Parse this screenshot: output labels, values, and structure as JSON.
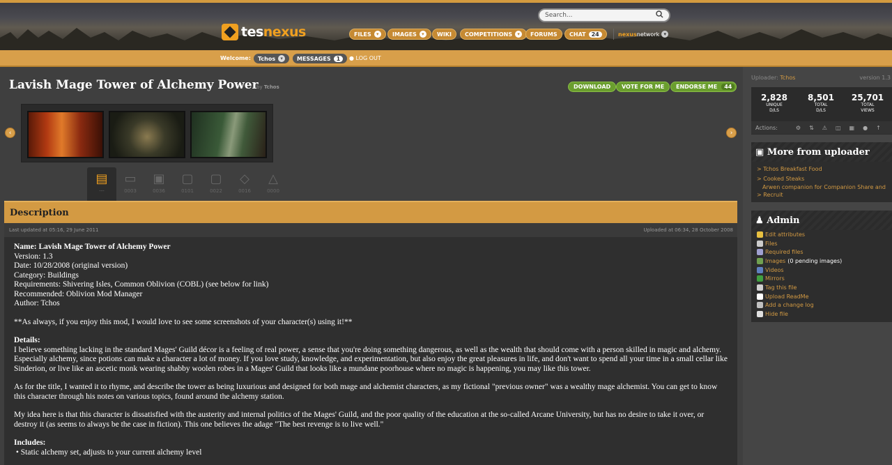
{
  "header": {
    "logo_prefix": "tes",
    "logo_suffix": "nexus",
    "search_placeholder": "Search...",
    "nav": [
      {
        "label": "FILES"
      },
      {
        "label": "IMAGES"
      },
      {
        "label": "WIKI"
      },
      {
        "label": "COMPETITIONS"
      },
      {
        "label": "FORUMS"
      },
      {
        "label": "CHAT",
        "badge": "24"
      }
    ],
    "network_prefix": "nexus",
    "network_suffix": "network"
  },
  "welcome_bar": {
    "label": "Welcome:",
    "user": "Tchos",
    "messages_label": "MESSAGES",
    "messages_count": "1",
    "logout": "LOG OUT"
  },
  "file": {
    "title": "Lavish Mage Tower of Alchemy Power",
    "by": "by",
    "author": "Tchos",
    "buttons": {
      "download": "DOWNLOAD",
      "vote": "VOTE FOR ME",
      "endorse": "ENDORSE ME",
      "endorse_count": "44"
    }
  },
  "tabs": [
    {
      "name": "description",
      "icon": "document-icon",
      "label": "---"
    },
    {
      "name": "files",
      "icon": "folder-icon",
      "label": "0003"
    },
    {
      "name": "images",
      "icon": "image-icon",
      "label": "0036"
    },
    {
      "name": "comments",
      "icon": "comment-icon",
      "label": "0101"
    },
    {
      "name": "forum",
      "icon": "chat-icon",
      "label": "0022"
    },
    {
      "name": "tags",
      "icon": "tag-icon",
      "label": "0016"
    },
    {
      "name": "versions",
      "icon": "triangle-icon",
      "label": "0000"
    }
  ],
  "description": {
    "header": "Description",
    "last_updated": "Last updated at 05:16, 29 June 2011",
    "uploaded": "Uploaded at 06:34, 28 October 2008",
    "info": {
      "name": "Name: Lavish Mage Tower of Alchemy Power",
      "version": "Version: 1.3",
      "date": "Date: 10/28/2008 (original version)",
      "category": "Category: Buildings",
      "requirements": "Requirements: Shivering Isles, Common Oblivion (COBL) (see below for link)",
      "recommended": "Recommended: Oblivion Mod Manager",
      "author": "Author: Tchos"
    },
    "note": "**As always, if you enjoy this mod, I would love to see some screenshots of your character(s) using it!**",
    "details_title": "Details:",
    "details_text": "I believe something lacking in the standard Mages' Guild décor is a feeling of real power, a sense that you're doing something dangerous, as well as the wealth that should come with a person skilled in magic and alchemy. Especially alchemy, since potions can make a character a lot of money. If you love study, knowledge, and experimentation, but also enjoy the great pleasures in life, and don't want to spend all your time in a small cellar like Sinderion, or live like an ascetic monk wearing shabby woolen robes in a Mages' Guild that looks like a mundane poorhouse where no magic is happening, you may like this tower.",
    "para2": "As for the title, I wanted it to rhyme, and describe the tower as being luxurious and designed for both mage and alchemist characters, as my fictional \"previous owner\" was a wealthy mage alchemist. You can get to know this character through his notes on various topics, found around the alchemy station.",
    "para3": "My idea here is that this character is dissatisfied with the austerity and internal politics of the Mages' Guild, and the poor quality of the education at the so-called Arcane University, but has no desire to take it over, or destroy it (as seems to always be the case in fiction). This one believes the adage \"The best revenge is to live well.\"",
    "includes_title": "Includes:",
    "includes_first": "Static alchemy set, adjusts to your current alchemy level"
  },
  "sidebar": {
    "uploader_label": "Uploader:",
    "uploader": "Tchos",
    "version": "version 1.3",
    "stats": [
      {
        "value": "2,828",
        "l1": "UNIQUE",
        "l2": "D/LS"
      },
      {
        "value": "8,501",
        "l1": "TOTAL",
        "l2": "D/LS"
      },
      {
        "value": "25,701",
        "l1": "TOTAL",
        "l2": "VIEWS"
      }
    ],
    "actions_label": "Actions:",
    "more_title": "More from uploader",
    "more_items": [
      "> Tchos Breakfast Food",
      "> Cooked Steaks",
      "Arwen companion for Companion Share and",
      "> Recruit"
    ],
    "admin_title": "Admin",
    "admin_items": [
      {
        "label": "Edit attributes",
        "extra": "",
        "color": "#e8c040"
      },
      {
        "label": "Files",
        "extra": "",
        "color": "#cccccc"
      },
      {
        "label": "Required files",
        "extra": "",
        "color": "#a0a0d0"
      },
      {
        "label": "Images",
        "extra": " (0 pending images)",
        "color": "#70a050"
      },
      {
        "label": "Videos",
        "extra": "",
        "color": "#6080c0"
      },
      {
        "label": "Mirrors",
        "extra": "",
        "color": "#40a040"
      },
      {
        "label": "Tag this file",
        "extra": "",
        "color": "#d0d0d0"
      },
      {
        "label": "Upload ReadMe",
        "extra": "",
        "color": "#ffffff"
      },
      {
        "label": "Add a change log",
        "extra": "",
        "color": "#c0c0c0"
      },
      {
        "label": "Hide file",
        "extra": "",
        "color": "#e0e0e0"
      }
    ]
  }
}
